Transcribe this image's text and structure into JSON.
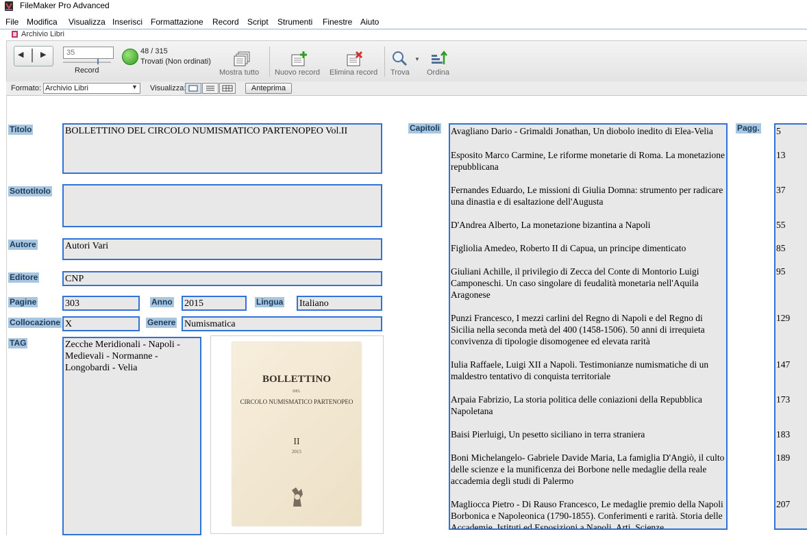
{
  "window": {
    "app_title": "FileMaker Pro Advanced",
    "doc_title": "Archivio Libri"
  },
  "menu": [
    "File",
    "Modifica",
    "Visualizza",
    "Inserisci",
    "Formattazione",
    "Record",
    "Script",
    "Strumenti",
    "Finestre",
    "Aiuto"
  ],
  "toolbar": {
    "record_value": "35",
    "record_label": "Record",
    "found_count": "48 / 315",
    "found_status": "Trovati (Non ordinati)",
    "show_all": "Mostra tutto",
    "new_record": "Nuovo record",
    "delete_record": "Elimina record",
    "find": "Trova",
    "sort": "Ordina"
  },
  "formatbar": {
    "format_label": "Formato:",
    "format_value": "Archivio Libri",
    "view_label": "Visualizza:",
    "preview": "Anteprima"
  },
  "labels": {
    "titolo": "Titolo",
    "sottotitolo": "Sottotitolo",
    "autore": "Autore",
    "editore": "Editore",
    "pagine": "Pagine",
    "anno": "Anno",
    "lingua": "Lingua",
    "collocazione": "Collocazione",
    "genere": "Genere",
    "tag": "TAG",
    "capitoli": "Capitoli",
    "pagg": "Pagg."
  },
  "record": {
    "titolo": "BOLLETTINO DEL CIRCOLO NUMISMATICO PARTENOPEO   Vol.II",
    "sottotitolo": "",
    "autore": "Autori Vari",
    "editore": "CNP",
    "pagine": "303",
    "anno": "2015",
    "lingua": "Italiano",
    "collocazione": "X",
    "genere": "Numismatica",
    "tag": "Zecche Meridionali - Napoli - Medievali - Normanne - Longobardi - Velia"
  },
  "cover": {
    "title": "BOLLETTINO",
    "del": "DEL",
    "subtitle": "CIRCOLO NUMISMATICO PARTENOPEO",
    "volume": "II",
    "year": "2015"
  },
  "chapters": [
    {
      "text": "Avagliano Dario - Grimaldi Jonathan, Un diobolo inedito di Elea-Velia",
      "page": "5"
    },
    {
      "text": "Esposito Marco Carmine, Le riforme monetarie di Roma. La monetazione repubblicana",
      "page": "13"
    },
    {
      "text": "Fernandes Eduardo, Le missioni di Giulia Domna: strumento per radicare una dinastia e di esaltazione dell'Augusta",
      "page": "37"
    },
    {
      "text": "D'Andrea Alberto, La monetazione bizantina a Napoli",
      "page": "55"
    },
    {
      "text": "Figliolia Amedeo, Roberto II di Capua, un principe dimenticato",
      "page": "85"
    },
    {
      "text": "Giuliani Achille, il privilegio di Zecca del Conte di Montorio Luigi Camponeschi. Un caso singolare di feudalità monetaria nell'Aquila Aragonese",
      "page": "95"
    },
    {
      "text": "Punzi Francesco, I mezzi carlini del Regno di Napoli e del Regno di Sicilia nella seconda metà del 400 (1458-1506). 50 anni di irrequieta convivenza di tipologie disomogenee ed elevata rarità",
      "page": "129"
    },
    {
      "text": "Iulia Raffaele, Luigi XII a Napoli. Testimonianze numismatiche di un maldestro tentativo di conquista territoriale",
      "page": "147"
    },
    {
      "text": "Arpaia Fabrizio, La storia politica delle coniazioni della Repubblica Napoletana",
      "page": "173"
    },
    {
      "text": "Baisi Pierluigi, Un pesetto siciliano in terra straniera",
      "page": "183"
    },
    {
      "text": "Boni Michelangelo- Gabriele Davide Maria, La famiglia D'Angiò, il culto delle scienze e la munificenza dei Borbone nelle medaglie della reale accademia degli studi di Palermo",
      "page": "189"
    },
    {
      "text": "Magliocca Pietro - Di Rauso Francesco, Le medaglie premio della Napoli Borbonica e Napoleonica (1790-1855). Conferimenti e rarità. Storia delle Accademie, Istituti ed Esposizioni a Napoli. Arti, Scienze",
      "page": "207"
    }
  ]
}
